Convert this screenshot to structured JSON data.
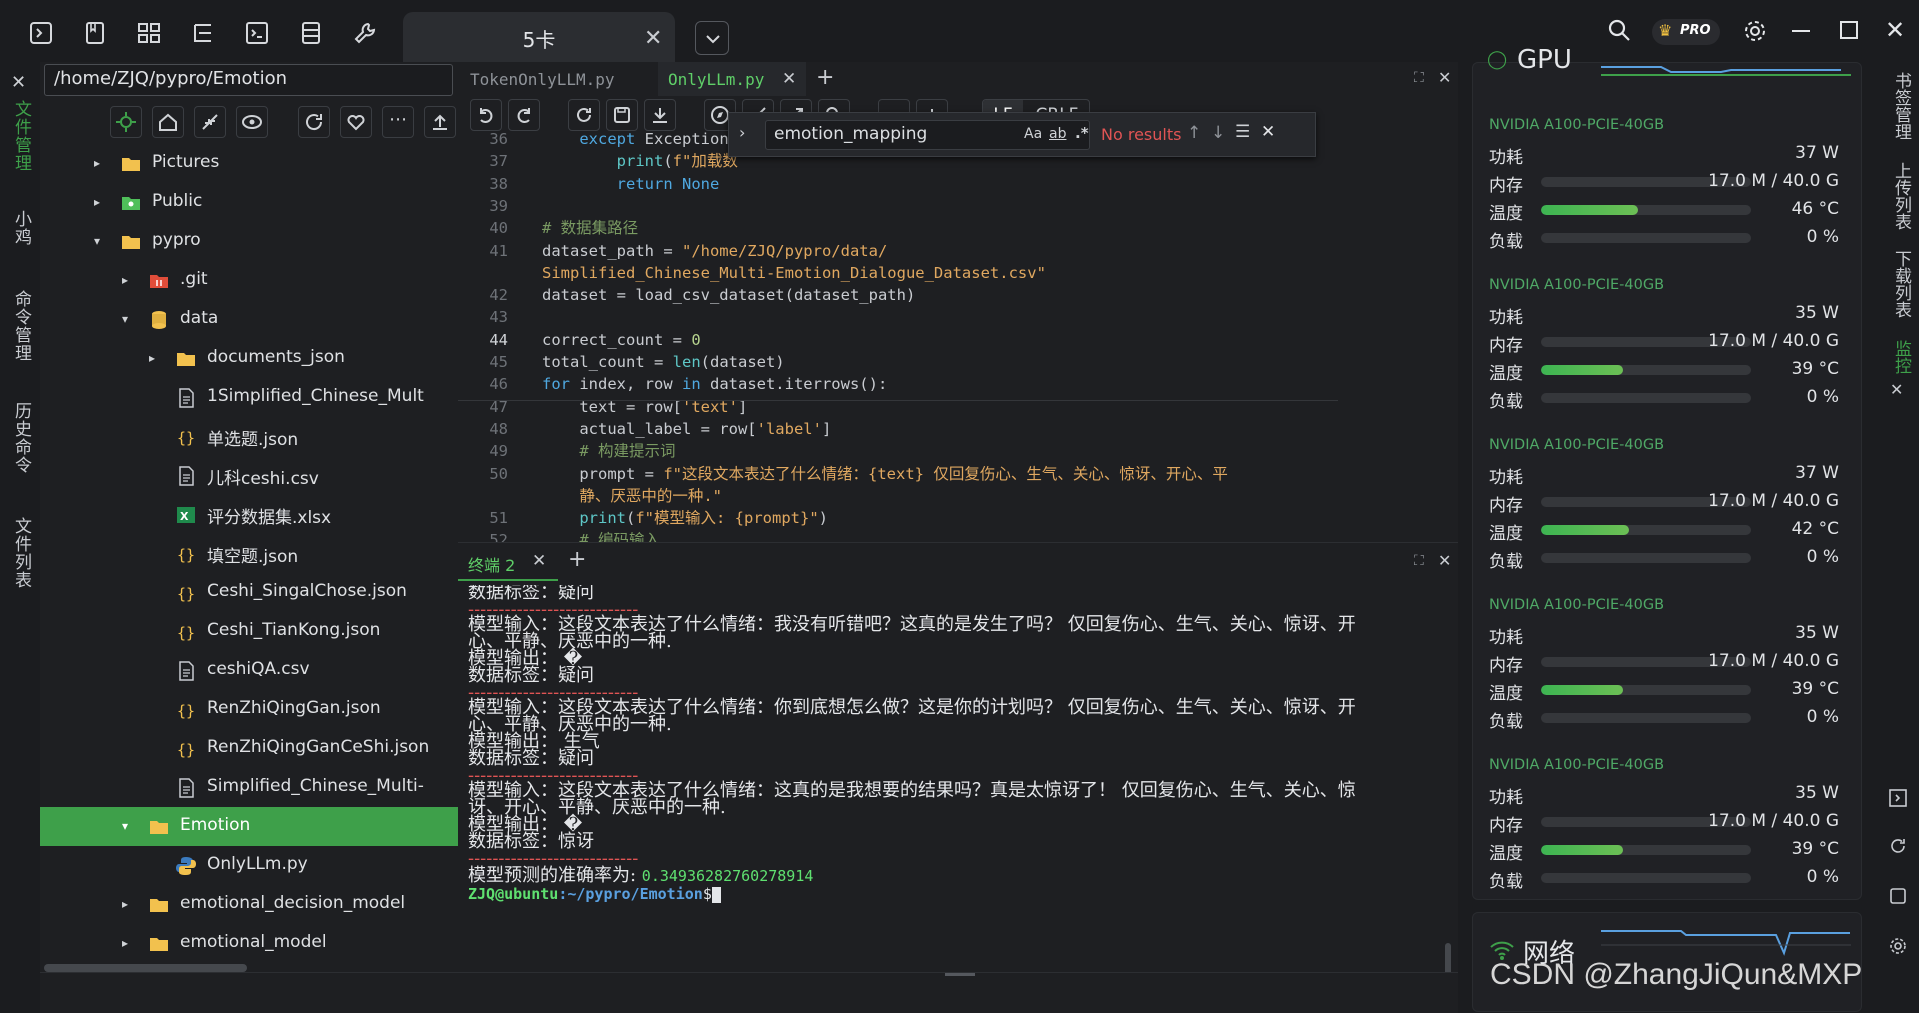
{
  "titlebar": {
    "session_tab": "5卡",
    "pro_badge": "PRO"
  },
  "left_rail": {
    "tabs": [
      "文件管理",
      "小鸡",
      "命令管理",
      "历史命令",
      "文件列表"
    ]
  },
  "file_panel": {
    "path": "/home/ZJQ/pypro/Emotion",
    "tree": [
      {
        "label": "Pictures",
        "indent": 0,
        "type": "folder",
        "arrow": "▸"
      },
      {
        "label": "Public",
        "indent": 0,
        "type": "folder-people",
        "arrow": "▸"
      },
      {
        "label": "pypro",
        "indent": 0,
        "type": "folder",
        "arrow": "▾"
      },
      {
        "label": ".git",
        "indent": 1,
        "type": "git",
        "arrow": "▸"
      },
      {
        "label": "data",
        "indent": 1,
        "type": "db",
        "arrow": "▾"
      },
      {
        "label": "documents_json",
        "indent": 2,
        "type": "folder",
        "arrow": "▸"
      },
      {
        "label": "1Simplified_Chinese_Mult",
        "indent": 2,
        "type": "file",
        "arrow": ""
      },
      {
        "label": "单选题.json",
        "indent": 2,
        "type": "json",
        "arrow": ""
      },
      {
        "label": "儿科ceshi.csv",
        "indent": 2,
        "type": "file",
        "arrow": ""
      },
      {
        "label": "评分数据集.xlsx",
        "indent": 2,
        "type": "excel",
        "arrow": ""
      },
      {
        "label": "填空题.json",
        "indent": 2,
        "type": "json",
        "arrow": ""
      },
      {
        "label": "Ceshi_SingalChose.json",
        "indent": 2,
        "type": "json",
        "arrow": ""
      },
      {
        "label": "Ceshi_TianKong.json",
        "indent": 2,
        "type": "json",
        "arrow": ""
      },
      {
        "label": "ceshiQA.csv",
        "indent": 2,
        "type": "file",
        "arrow": ""
      },
      {
        "label": "RenZhiQingGan.json",
        "indent": 2,
        "type": "json",
        "arrow": ""
      },
      {
        "label": "RenZhiQingGanCeShi.json",
        "indent": 2,
        "type": "json",
        "arrow": ""
      },
      {
        "label": "Simplified_Chinese_Multi-",
        "indent": 2,
        "type": "file",
        "arrow": ""
      },
      {
        "label": "Emotion",
        "indent": 1,
        "type": "folder",
        "arrow": "▾",
        "selected": true
      },
      {
        "label": "OnlyLLm.py",
        "indent": 2,
        "type": "python",
        "arrow": ""
      },
      {
        "label": "emotional_decision_model",
        "indent": 1,
        "type": "folder",
        "arrow": "▸"
      },
      {
        "label": "emotional_model",
        "indent": 1,
        "type": "folder",
        "arrow": "▸"
      }
    ]
  },
  "editor": {
    "tabs": [
      {
        "label": "TokenOnlyLLM.py",
        "active": false
      },
      {
        "label": "OnlyLLm.py",
        "active": true
      }
    ],
    "lf_label": "LF",
    "crlf_label": "CRLF",
    "find": {
      "value": "emotion_mapping",
      "opt_case": "Aa",
      "opt_word": "ab",
      "opt_regex": ".*",
      "result": "No results"
    },
    "lines": [
      {
        "n": "36",
        "html": "    <span class='kw'>except</span> Exception"
      },
      {
        "n": "37",
        "html": "        <span class='fn'>print</span>(<span class='str'>f\"加载数</span>"
      },
      {
        "n": "38",
        "html": "        <span class='kw'>return</span> <span class='kw'>None</span>"
      },
      {
        "n": "39",
        "html": ""
      },
      {
        "n": "40",
        "html": "<span class='cm'># 数据集路径</span>"
      },
      {
        "n": "41",
        "html": "dataset_path = <span class='str'>\"/home/ZJQ/pypro/data/</span>"
      },
      {
        "n": "",
        "html": "<span class='str'>Simplified_Chinese_Multi-Emotion_Dialogue_Dataset.csv\"</span>"
      },
      {
        "n": "42",
        "html": "dataset = load_csv_dataset(dataset_path)"
      },
      {
        "n": "43",
        "html": ""
      },
      {
        "n": "44",
        "html": "correct_count = <span class='num'>0</span>",
        "cur": true
      },
      {
        "n": "45",
        "html": "total_count = <span class='fn'>len</span>(dataset)"
      },
      {
        "n": "46",
        "html": "<span class='kw'>for</span> index, row <span class='kw'>in</span> dataset.iterrows():"
      },
      {
        "n": "47",
        "html": "    text = row[<span class='str'>'text'</span>]"
      },
      {
        "n": "48",
        "html": "    actual_label = row[<span class='str'>'label'</span>]"
      },
      {
        "n": "49",
        "html": "    <span class='cm'># 构建提示词</span>"
      },
      {
        "n": "50",
        "html": "    prompt = <span class='str'>f\"这段文本表达了什么情绪：{text} 仅回复伤心、生气、关心、惊讶、开心、平</span>"
      },
      {
        "n": "",
        "html": "    <span class='str'>静、厌恶中的一种.\"</span>"
      },
      {
        "n": "51",
        "html": "    <span class='fn'>print</span>(<span class='str'>f\"模型输入: {prompt}\"</span>)"
      },
      {
        "n": "52",
        "html": "    <span class='cm'># 编码输入</span>"
      }
    ]
  },
  "terminal": {
    "tab_label": "终端 2",
    "lines": [
      {
        "t": "数据标签：疑问",
        "c": ""
      },
      {
        "t": "----------------------------",
        "c": "dash"
      },
      {
        "t": "模型输入：这段文本表达了什么情绪：我没有听错吧？这真的是发生了吗？ 仅回复伤心、生气、关心、惊讶、开",
        "c": ""
      },
      {
        "t": "心、平静、厌恶中的一种.",
        "c": ""
      },
      {
        "t": "模型输出： �",
        "c": ""
      },
      {
        "t": "数据标签：疑问",
        "c": ""
      },
      {
        "t": "----------------------------",
        "c": "dash"
      },
      {
        "t": "模型输入：这段文本表达了什么情绪：你到底想怎么做？这是你的计划吗？ 仅回复伤心、生气、关心、惊讶、开",
        "c": ""
      },
      {
        "t": "心、平静、厌恶中的一种.",
        "c": ""
      },
      {
        "t": "模型输出： 生气",
        "c": ""
      },
      {
        "t": "数据标签：疑问",
        "c": ""
      },
      {
        "t": "----------------------------",
        "c": "dash"
      },
      {
        "t": "模型输入：这段文本表达了什么情绪：这真的是我想要的结果吗？真是太惊讶了！ 仅回复伤心、生气、关心、惊",
        "c": ""
      },
      {
        "t": "讶、开心、平静、厌恶中的一种.",
        "c": ""
      },
      {
        "t": "模型输出： �",
        "c": ""
      },
      {
        "t": "数据标签：惊讶",
        "c": ""
      },
      {
        "t": "----------------------------",
        "c": "dash"
      }
    ],
    "accuracy_label": "模型预测的准确率为: ",
    "accuracy_value": "0.34936282760278914",
    "prompt_user": "ZJQ@ubuntu",
    "prompt_path": ":~/pypro/Emotion",
    "prompt_symbol": "$"
  },
  "monitor": {
    "gpu_header": "GPU",
    "labels": {
      "power": "功耗",
      "memory": "内存",
      "temp": "温度",
      "load": "负载"
    },
    "gpus": [
      {
        "name": "NVIDIA A100-PCIE-40GB",
        "power": "37 W",
        "memory": "17.0 M / 40.0 G",
        "mem_frac": 0.0,
        "temp": "46 °C",
        "temp_frac": 0.46,
        "load": "0 %",
        "load_frac": 0
      },
      {
        "name": "NVIDIA A100-PCIE-40GB",
        "power": "35 W",
        "memory": "17.0 M / 40.0 G",
        "mem_frac": 0.0,
        "temp": "39 °C",
        "temp_frac": 0.39,
        "load": "0 %",
        "load_frac": 0
      },
      {
        "name": "NVIDIA A100-PCIE-40GB",
        "power": "37 W",
        "memory": "17.0 M / 40.0 G",
        "mem_frac": 0.0,
        "temp": "42 °C",
        "temp_frac": 0.42,
        "load": "0 %",
        "load_frac": 0
      },
      {
        "name": "NVIDIA A100-PCIE-40GB",
        "power": "35 W",
        "memory": "17.0 M / 40.0 G",
        "mem_frac": 0.0,
        "temp": "39 °C",
        "temp_frac": 0.39,
        "load": "0 %",
        "load_frac": 0
      },
      {
        "name": "NVIDIA A100-PCIE-40GB",
        "power": "35 W",
        "memory": "17.0 M / 40.0 G",
        "mem_frac": 0.0,
        "temp": "39 °C",
        "temp_frac": 0.39,
        "load": "0 %",
        "load_frac": 0
      }
    ],
    "network_label": "网络"
  },
  "right_rail": {
    "tabs": [
      "书签管理",
      "上传列表",
      "下载列表",
      "监控"
    ]
  },
  "watermark": "CSDN @ZhangJiQun&MXP",
  "colors": {
    "accent": "#3ea04a",
    "brand_green": "#4fa866"
  }
}
